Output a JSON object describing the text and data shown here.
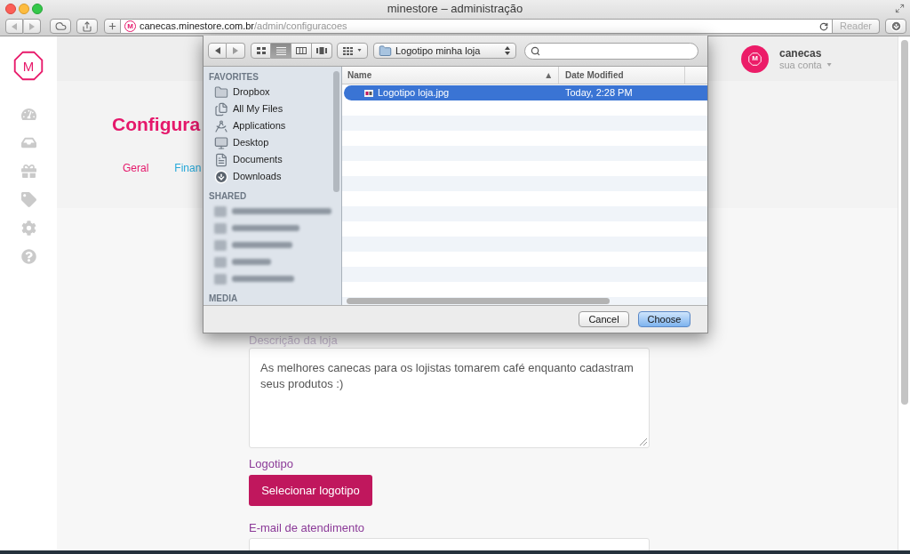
{
  "browser": {
    "title": "minestore – administração",
    "favicon_letter": "M",
    "url": {
      "host": "canecas.minestore.com.br",
      "path": "/admin/configuracoes"
    },
    "reader_button": "Reader"
  },
  "sidebar": {
    "logo_letter": "M",
    "nav": [
      {
        "kind": "dashboard"
      },
      {
        "kind": "inbox"
      },
      {
        "kind": "gift"
      },
      {
        "kind": "tag"
      },
      {
        "kind": "settings"
      },
      {
        "kind": "help"
      }
    ]
  },
  "header": {
    "avatar_letter": "M",
    "user_name": "canecas",
    "account_menu": "sua conta"
  },
  "page": {
    "title": "Configura",
    "tabs": [
      {
        "label": "Geral",
        "selected": true
      },
      {
        "label": "Finan",
        "selected": false
      }
    ]
  },
  "form": {
    "description_label": "Descrição da loja",
    "description_value": "As melhores canecas para os lojistas tomarem café enquanto cadastram seus produtos :)",
    "logo_label": "Logotipo",
    "logo_button": "Selecionar logotipo",
    "email_label": "E-mail de atendimento"
  },
  "file_dialog": {
    "view_buttons": [
      {
        "kind": "icons",
        "selected": false
      },
      {
        "kind": "list",
        "selected": true
      },
      {
        "kind": "columns",
        "selected": false
      },
      {
        "kind": "coverflow",
        "selected": false
      }
    ],
    "location": "Logotipo minha loja",
    "sidebar": [
      {
        "heading": "FAVORITES",
        "items": [
          {
            "kind": "folder",
            "label": "Dropbox"
          },
          {
            "kind": "files",
            "label": "All My Files"
          },
          {
            "kind": "applications",
            "label": "Applications"
          },
          {
            "kind": "desktop",
            "label": "Desktop"
          },
          {
            "kind": "documents",
            "label": "Documents"
          },
          {
            "kind": "downloads",
            "label": "Downloads"
          }
        ]
      },
      {
        "heading": "SHARED",
        "items": [
          {
            "kind": "blurred"
          },
          {
            "kind": "blurred"
          },
          {
            "kind": "blurred"
          },
          {
            "kind": "blurred"
          },
          {
            "kind": "blurred"
          }
        ]
      },
      {
        "heading": "MEDIA"
      }
    ],
    "columns": [
      {
        "label": "Name",
        "sorted": true
      },
      {
        "label": "Date Modified",
        "sorted": false
      }
    ],
    "files": [
      {
        "name": "Logotipo loja.jpg",
        "modified": "Today, 2:28 PM",
        "selected": true
      }
    ],
    "buttons": [
      {
        "label": "Cancel",
        "kind": "default"
      },
      {
        "label": "Choose",
        "kind": "primary"
      }
    ]
  }
}
